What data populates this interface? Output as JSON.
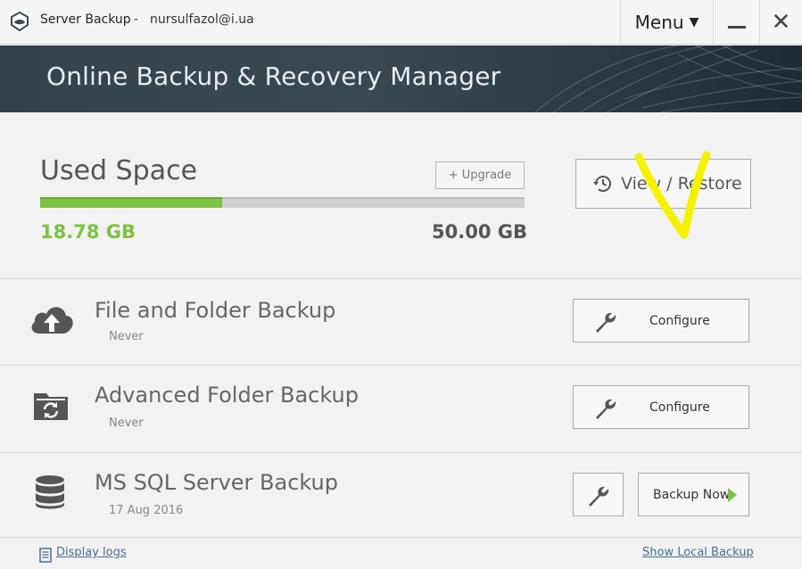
{
  "titlebar": {
    "app_name": "Server Backup",
    "separator": "-",
    "user_email": "nursulfazol@i.ua",
    "menu_label": "Menu",
    "menu_caret": "▼",
    "close_glyph": "✕"
  },
  "banner": {
    "title": "Online Backup & Recovery Manager"
  },
  "used_space": {
    "title": "Used Space",
    "upgrade_label": "+ Upgrade",
    "used": "18.78 GB",
    "total": "50.00 GB",
    "fraction_used": 0.3756
  },
  "view_restore": {
    "label": "View / Restore",
    "icon": "history-icon"
  },
  "backups": [
    {
      "title": "File and Folder Backup",
      "status": "Never",
      "icon": "cloud-upload-icon",
      "action_label": "Configure"
    },
    {
      "title": "Advanced Folder Backup",
      "status": "Never",
      "icon": "folder-sync-icon",
      "action_label": "Configure"
    },
    {
      "title": "MS SQL Server Backup",
      "status": "17 Aug 2016",
      "icon": "database-icon",
      "action_label": "Backup Now"
    }
  ],
  "footer": {
    "display_logs": "Display logs",
    "show_local_backup": "Show Local Backup"
  },
  "colors": {
    "accent_green": "#7dc242",
    "banner_bg": "#34424b",
    "link_blue": "#4a6e93",
    "annotation_yellow": "#f5f200"
  }
}
